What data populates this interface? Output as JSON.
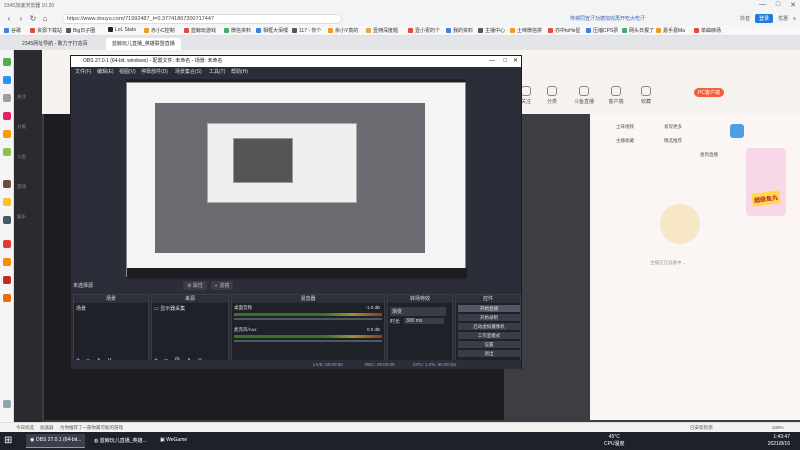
{
  "browser": {
    "window_title": "2345加速浏览器 10.20",
    "url": "https://www.douyu.com/71992487_t=0.37741867300717447",
    "promo": "传祺同宣汗功德加完再开吃大吃汗",
    "ext": [
      "抖音",
      "登录",
      "优惠",
      "注册/登录"
    ],
    "bookmarks": [
      "谷歌",
      "资源下载站",
      "Big日子圈",
      "LoL Stats",
      "赤小C控制",
      "蓝鲸玩游戏",
      "微信资料",
      "相框大佰嘿",
      "117 - 你个",
      "余小Y真的",
      "壹佣深度题",
      "壹小祝的个",
      "我的资料",
      "主播中心",
      "土味微信拼",
      "亦中toHe星",
      "压缩CPS票",
      "网头日报了",
      "嘉手嘉Ma",
      "单曲映场"
    ],
    "tabs": [
      "2345网址导航 - 致力于打造百",
      "蓝鲸玩儿直播_英雄联盟直播"
    ]
  },
  "douyu": {
    "nav": [
      "关注",
      "分类",
      "斗鱼直播",
      "客户端",
      "收藏"
    ],
    "left_items": [
      "关注",
      "分类",
      "斗鱼",
      "游戏",
      "娱乐"
    ],
    "pc_client": "PC客户端",
    "right_items": [
      "土味视频",
      "发现更多",
      "主播收藏",
      "精选推荐",
      "壹到直播"
    ],
    "gift_tag": "超级鱼丸",
    "anchor_note": "主播正在准备中..."
  },
  "obs": {
    "title": "OBS 27.0.1 (64-bit, windows) - 配置文件: 未命名 - 场景: 未命名",
    "menu": [
      "文件(F)",
      "编辑(E)",
      "视图(V)",
      "停靠部件(D)",
      "场景集合(S)",
      "工具(T)",
      "帮助(H)"
    ],
    "no_source": "未选择源",
    "props_btn": "属性",
    "filters_btn": "滤镜",
    "docks": {
      "scenes": {
        "title": "场景",
        "items": [
          "场景"
        ],
        "foot": "+ − ∧ ∨"
      },
      "sources": {
        "title": "来源",
        "items": [
          "显示器采集"
        ],
        "foot": "+ − ⚙ ∧ ∨"
      },
      "mixer": {
        "title": "混音器",
        "tracks": [
          {
            "name": "桌面音频",
            "db": "-1.0 dB"
          },
          {
            "name": "麦克风/Aux",
            "db": "0.0 dB"
          }
        ]
      },
      "transitions": {
        "title": "转场特效",
        "type": "渐变",
        "duration_label": "时长",
        "duration": "300 ms"
      },
      "controls": {
        "title": "控件",
        "buttons": [
          "开始直播",
          "开始录制",
          "启动虚拟摄像机",
          "工作室模式",
          "设置",
          "退出"
        ]
      }
    },
    "status": {
      "live": "LIVE: 00:00:00",
      "rec": "REC: 00:00:00",
      "cpu": "CPU: 1.0%, 60.00 fps",
      "dropped": "丢帧 0 (0.0%)"
    }
  },
  "bottom_bar": [
    "今日优选",
    "加速器",
    "为你推荐了一部你最可能的游戏",
    "已安装检测",
    "100%"
  ],
  "taskbar": {
    "items": [
      "OBS 27.0.1 (64-bit...",
      "蓝鲸玩儿直播_英雄...",
      "WeGame"
    ],
    "temp": "45°C",
    "cpu_label": "CPU温度",
    "time": "1:43:47",
    "date": "2021/8/16"
  },
  "colors": {
    "obs_bg": "#2b2e38",
    "douyu_accent": "#f0603b",
    "taskbar": "#1e2129"
  }
}
